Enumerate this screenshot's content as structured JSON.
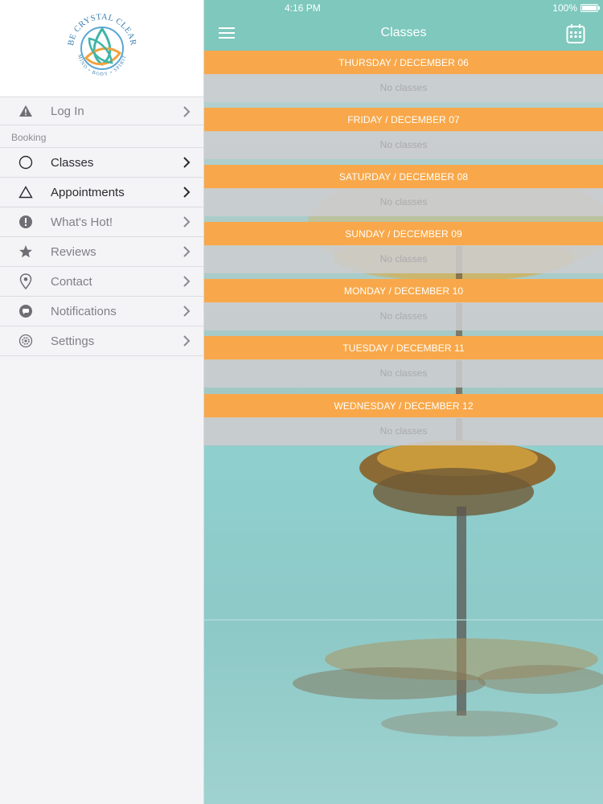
{
  "status": {
    "time": "4:16 PM",
    "battery": "100%"
  },
  "brand": {
    "top_text": "BE CRYSTAL CLEAR",
    "bottom_text": "MIND • BODY • SPIRIT",
    "colors": {
      "teal": "#3fb5a8",
      "orange": "#f2a23c",
      "blue": "#5aa6d4"
    }
  },
  "sidebar": {
    "login": {
      "label": "Log In",
      "icon": "warning-icon"
    },
    "section_label": "Booking",
    "items": [
      {
        "label": "Classes",
        "icon": "circle-icon",
        "active": true
      },
      {
        "label": "Appointments",
        "icon": "triangle-icon",
        "active": true
      },
      {
        "label": "What's Hot!",
        "icon": "exclamation-icon",
        "active": false
      },
      {
        "label": "Reviews",
        "icon": "star-icon",
        "active": false
      },
      {
        "label": "Contact",
        "icon": "location-pin-icon",
        "active": false
      },
      {
        "label": "Notifications",
        "icon": "chat-bubble-icon",
        "active": false
      },
      {
        "label": "Settings",
        "icon": "gear-icon",
        "active": false
      }
    ]
  },
  "header": {
    "title": "Classes",
    "menu_icon": "hamburger-icon",
    "calendar_icon": "calendar-icon"
  },
  "days": [
    {
      "label": "THURSDAY / DECEMBER 06",
      "empty_text": "No classes"
    },
    {
      "label": "FRIDAY / DECEMBER 07",
      "empty_text": "No classes"
    },
    {
      "label": "SATURDAY / DECEMBER 08",
      "empty_text": "No classes"
    },
    {
      "label": "SUNDAY / DECEMBER 09",
      "empty_text": "No classes"
    },
    {
      "label": "MONDAY / DECEMBER 10",
      "empty_text": "No classes"
    },
    {
      "label": "TUESDAY / DECEMBER 11",
      "empty_text": "No classes"
    },
    {
      "label": "WEDNESDAY / DECEMBER 12",
      "empty_text": "No classes"
    }
  ],
  "colors": {
    "nav_teal": "#7ec8bd",
    "day_header_orange": "#f8a84a",
    "empty_row_grey": "#cdcdd0",
    "water": "#8fd0cf"
  }
}
